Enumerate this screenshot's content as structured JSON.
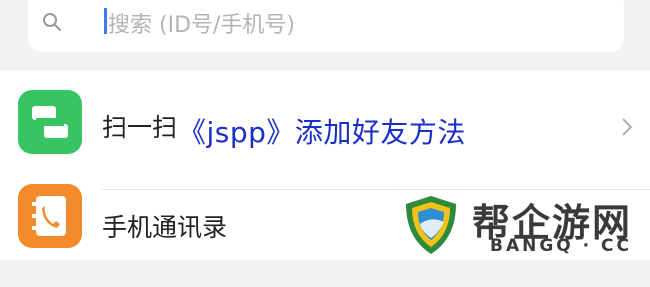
{
  "search": {
    "placeholder": "搜索 (ID号/手机号)"
  },
  "menu": {
    "items": [
      {
        "label": "扫一扫",
        "icon": "scan-icon"
      },
      {
        "label": "手机通讯录",
        "icon": "phone-contacts-icon"
      }
    ]
  },
  "overlay": {
    "title": "《jspp》添加好友方法"
  },
  "watermark": {
    "name": "帮企游网",
    "domain": "BANGQ · CC"
  },
  "colors": {
    "accent_blue": "#1a2fc8",
    "scan_green": "#37c463",
    "contacts_orange": "#f28a2e",
    "cursor_blue": "#3a7bf6"
  }
}
